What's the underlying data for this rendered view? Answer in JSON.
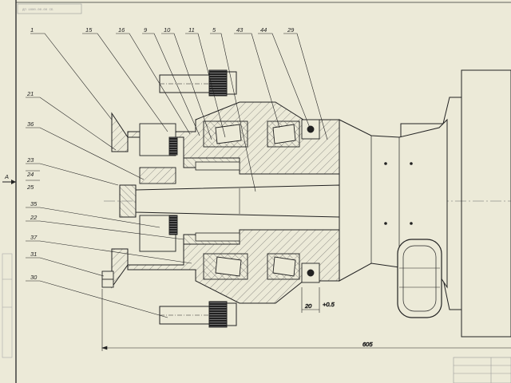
{
  "drawing": {
    "stamp": "ДП 1000.00.00 СБ",
    "section_mark": "A",
    "callouts_top": [
      "1",
      "15",
      "16",
      "9",
      "10",
      "11",
      "5",
      "43",
      "44",
      "29"
    ],
    "callouts_left": [
      "21",
      "36",
      "23",
      "24",
      "25",
      "35",
      "22",
      "37",
      "31",
      "30"
    ],
    "dimensions": {
      "overall": "605",
      "seal_offset": "20",
      "tolerance": "+0.5"
    }
  }
}
